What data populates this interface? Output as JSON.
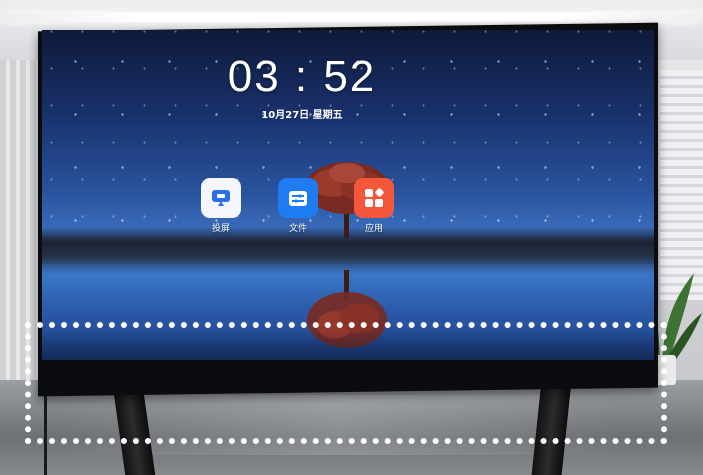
{
  "screen": {
    "clock": "03 : 52",
    "date": "10月27日  星期五"
  },
  "apps": [
    {
      "label": "投屏",
      "icon": "screen-cast-icon",
      "color": "#f4f6fb"
    },
    {
      "label": "文件",
      "icon": "file-manager-icon",
      "color": "#1f7bf2"
    },
    {
      "label": "应用",
      "icon": "app-grid-icon",
      "color": "#f4573a"
    }
  ],
  "colors": {
    "selection_outline": "#ffffff",
    "screen_sky": "#2a55a0"
  }
}
